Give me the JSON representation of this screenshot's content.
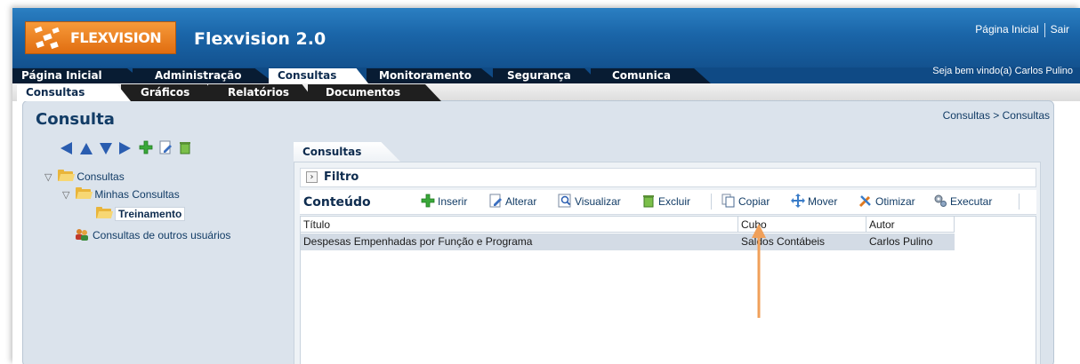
{
  "header": {
    "brand": "FLEXVISION",
    "app_title": "Flexvision 2.0",
    "home_link": "Página Inicial",
    "logout_link": "Sair",
    "welcome": "Seja bem vindo(a) Carlos Pulino"
  },
  "main_tabs": [
    {
      "label": "Página Inicial",
      "active": false
    },
    {
      "label": "Administração",
      "active": false
    },
    {
      "label": "Consultas",
      "active": true
    },
    {
      "label": "Monitoramento",
      "active": false
    },
    {
      "label": "Segurança",
      "active": false
    },
    {
      "label": "Comunica",
      "active": false
    }
  ],
  "sub_tabs": [
    {
      "label": "Consultas",
      "active": true
    },
    {
      "label": "Gráficos",
      "active": false
    },
    {
      "label": "Relatórios",
      "active": false
    },
    {
      "label": "Documentos",
      "active": false
    }
  ],
  "page": {
    "title": "Consulta",
    "breadcrumb": "Consultas > Consultas"
  },
  "tree": {
    "toolbar_icons": [
      "move-left-icon",
      "move-up-icon",
      "move-down-icon",
      "move-right-icon",
      "add-icon",
      "edit-icon",
      "delete-icon"
    ],
    "items": [
      {
        "label": "Consultas",
        "icon": "folder-open-icon",
        "expander": "▽"
      },
      {
        "label": "Minhas Consultas",
        "icon": "folder-open-icon",
        "expander": "▽"
      },
      {
        "label": "Treinamento",
        "icon": "folder-open-icon",
        "selected": true
      },
      {
        "label": "Consultas de outros usuários",
        "icon": "users-icon"
      }
    ]
  },
  "right_panel": {
    "tab_label": "Consultas",
    "filter_label": "Filtro",
    "content_label": "Conteúdo",
    "toolbar": [
      {
        "label": "Inserir",
        "icon": "add-icon"
      },
      {
        "label": "Alterar",
        "icon": "edit-icon"
      },
      {
        "label": "Visualizar",
        "icon": "view-icon"
      },
      {
        "label": "Excluir",
        "icon": "delete-icon"
      },
      {
        "label": "Copiar",
        "icon": "copy-icon"
      },
      {
        "label": "Mover",
        "icon": "move-icon"
      },
      {
        "label": "Otimizar",
        "icon": "tools-icon"
      },
      {
        "label": "Executar",
        "icon": "gears-icon"
      }
    ],
    "grid": {
      "columns": [
        "Título",
        "Cubo",
        "Autor"
      ],
      "rows": [
        [
          "Despesas Empenhadas por Função e Programa",
          "Saldos Contábeis",
          "Carlos Pulino"
        ]
      ]
    }
  },
  "colors": {
    "header_blue": "#1a65a8",
    "brand_orange": "#f0831f",
    "annotation_arrow": "#f0a05a",
    "selected_row": "#d3dbe5"
  }
}
